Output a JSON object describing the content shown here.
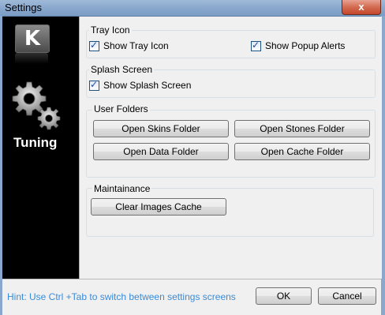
{
  "window": {
    "title": "Settings",
    "close_label": "x"
  },
  "sidebar": {
    "logo_letter": "K",
    "section_label": "Tuning"
  },
  "tray_icon": {
    "title": "Tray Icon",
    "show_tray_icon": {
      "label": "Show Tray Icon",
      "checked": true
    },
    "show_popup_alerts": {
      "label": "Show Popup Alerts",
      "checked": true
    }
  },
  "splash_screen": {
    "title": "Splash Screen",
    "show_splash_screen": {
      "label": "Show Splash Screen",
      "checked": true
    }
  },
  "user_folders": {
    "title": "User Folders",
    "open_skins": "Open Skins Folder",
    "open_stones": "Open Stones Folder",
    "open_data": "Open Data Folder",
    "open_cache": "Open Cache Folder"
  },
  "maintainance": {
    "title": "Maintainance",
    "clear_cache": "Clear Images Cache"
  },
  "footer": {
    "hint": "Hint: Use Ctrl +Tab to switch between settings screens",
    "ok": "OK",
    "cancel": "Cancel"
  }
}
